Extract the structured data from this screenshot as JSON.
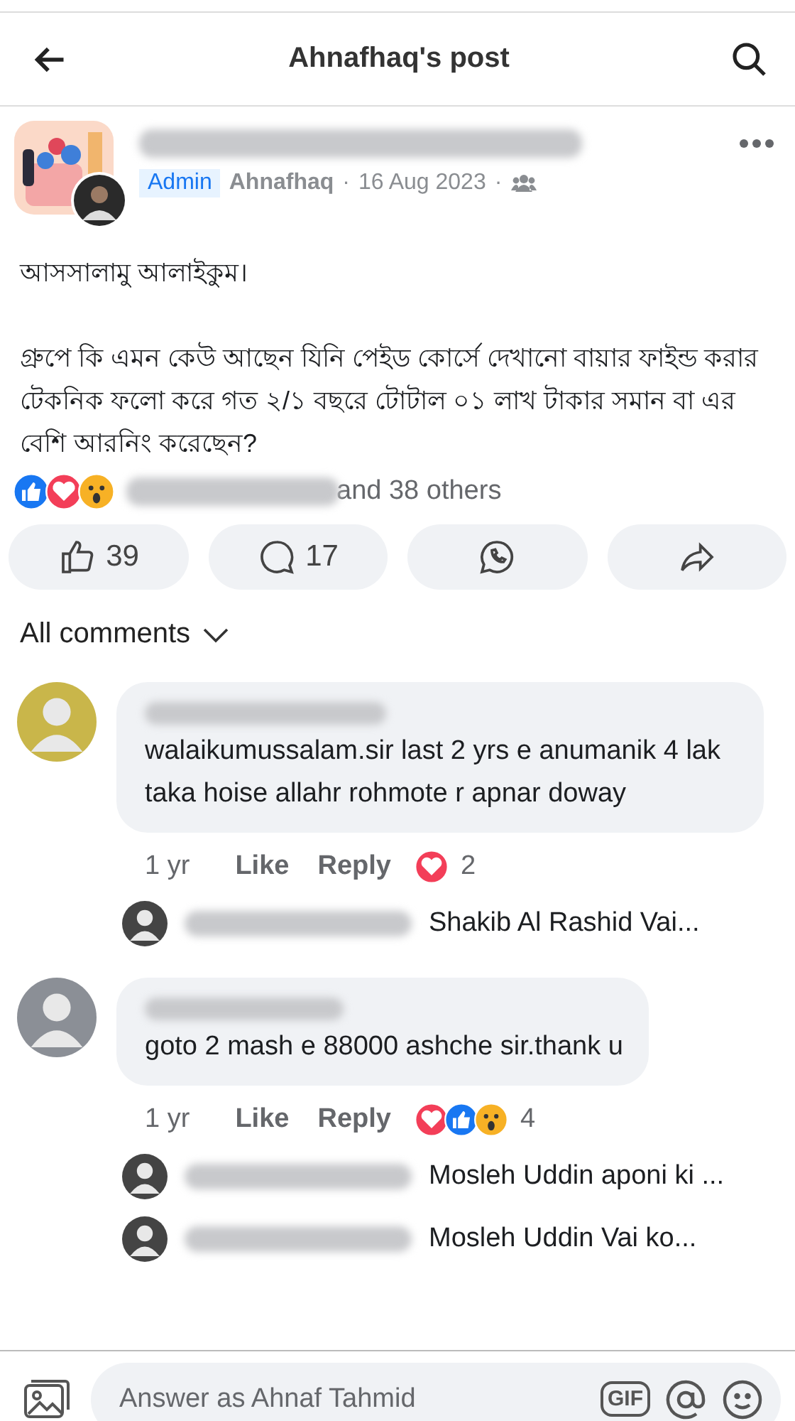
{
  "header": {
    "title": "Ahnafhaq's post"
  },
  "post": {
    "badge": "Admin",
    "author": "Ahnafhaq",
    "separator": "·",
    "date": "16 Aug 2023",
    "greeting": "আসসালামু আলাইকুম।",
    "body": "গ্রুপে কি এমন কেউ আছেন যিনি পেইড কোর্সে দেখানো বায়ার ফাইন্ড করার টেকনিক ফলো করে গত ২/১ বছরে টোটাল ০১ লাখ টাকার সমান বা এর বেশি আরনিং করেছেন?",
    "reactions": [
      {
        "kind": "like"
      },
      {
        "kind": "love"
      },
      {
        "kind": "wow"
      }
    ],
    "reaction_summary": "and 38 others"
  },
  "actions": [
    {
      "kind": "like",
      "count": "39"
    },
    {
      "kind": "comment",
      "count": "17"
    },
    {
      "kind": "whatsapp"
    },
    {
      "kind": "share"
    }
  ],
  "comments_filter": "All comments",
  "comments": [
    {
      "text": "walaikumussalam.sir last 2 yrs e anumanik 4 lak taka hoise allahr rohmote r apnar doway",
      "time": "1 yr",
      "like": "Like",
      "reply": "Reply",
      "reactions": [
        {
          "kind": "love"
        }
      ],
      "reaction_count": "2",
      "replies": [
        {
          "text": "Shakib Al Rashid Vai..."
        }
      ]
    },
    {
      "text": "goto 2 mash e 88000 ashche sir.thank u",
      "time": "1 yr",
      "like": "Like",
      "reply": "Reply",
      "reactions": [
        {
          "kind": "love"
        },
        {
          "kind": "like"
        },
        {
          "kind": "wow"
        }
      ],
      "reaction_count": "4",
      "replies": [
        {
          "text": "Mosleh Uddin aponi ki ..."
        },
        {
          "text": "Mosleh Uddin Vai ko..."
        }
      ]
    }
  ],
  "composer": {
    "placeholder": "Answer as Ahnaf Tahmid",
    "gif": "GIF"
  }
}
